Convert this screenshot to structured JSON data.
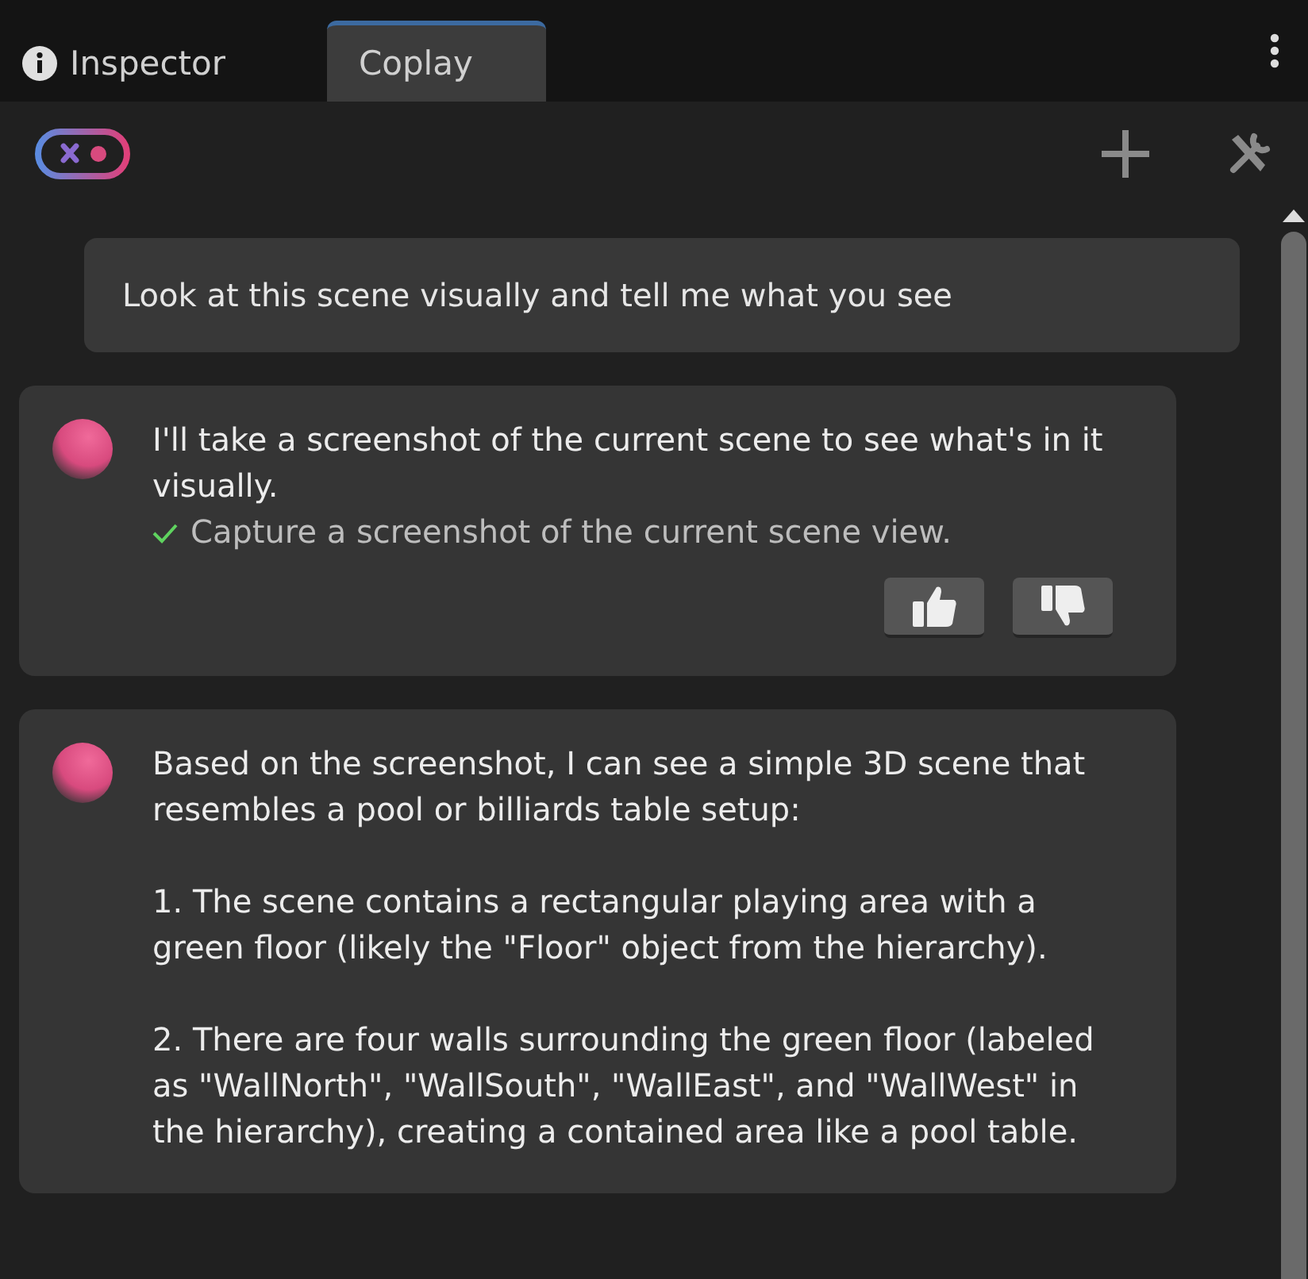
{
  "tabs": [
    {
      "label": "Inspector",
      "selected": false
    },
    {
      "label": "Coplay",
      "selected": true
    }
  ],
  "messages": [
    {
      "kind": "user",
      "text": "Look at this scene visually and tell me what you see"
    },
    {
      "kind": "assistant",
      "paragraphs": [
        "I'll take a screenshot of the current scene to see what's in it visually."
      ],
      "tool_steps": [
        {
          "text": "Capture a screenshot of the current scene view.",
          "done": true
        }
      ],
      "feedback": true
    },
    {
      "kind": "assistant",
      "paragraphs": [
        "Based on the screenshot, I can see a simple 3D scene that resembles a pool or billiards table setup:",
        "1. The scene contains a rectangular playing area with a green floor (likely the \"Floor\" object from the hierarchy).",
        "2. There are four walls surrounding the green floor (labeled as \"WallNorth\", \"WallSouth\", \"WallEast\", and \"WallWest\" in the hierarchy), creating a contained area like a pool table."
      ],
      "feedback": false
    }
  ]
}
